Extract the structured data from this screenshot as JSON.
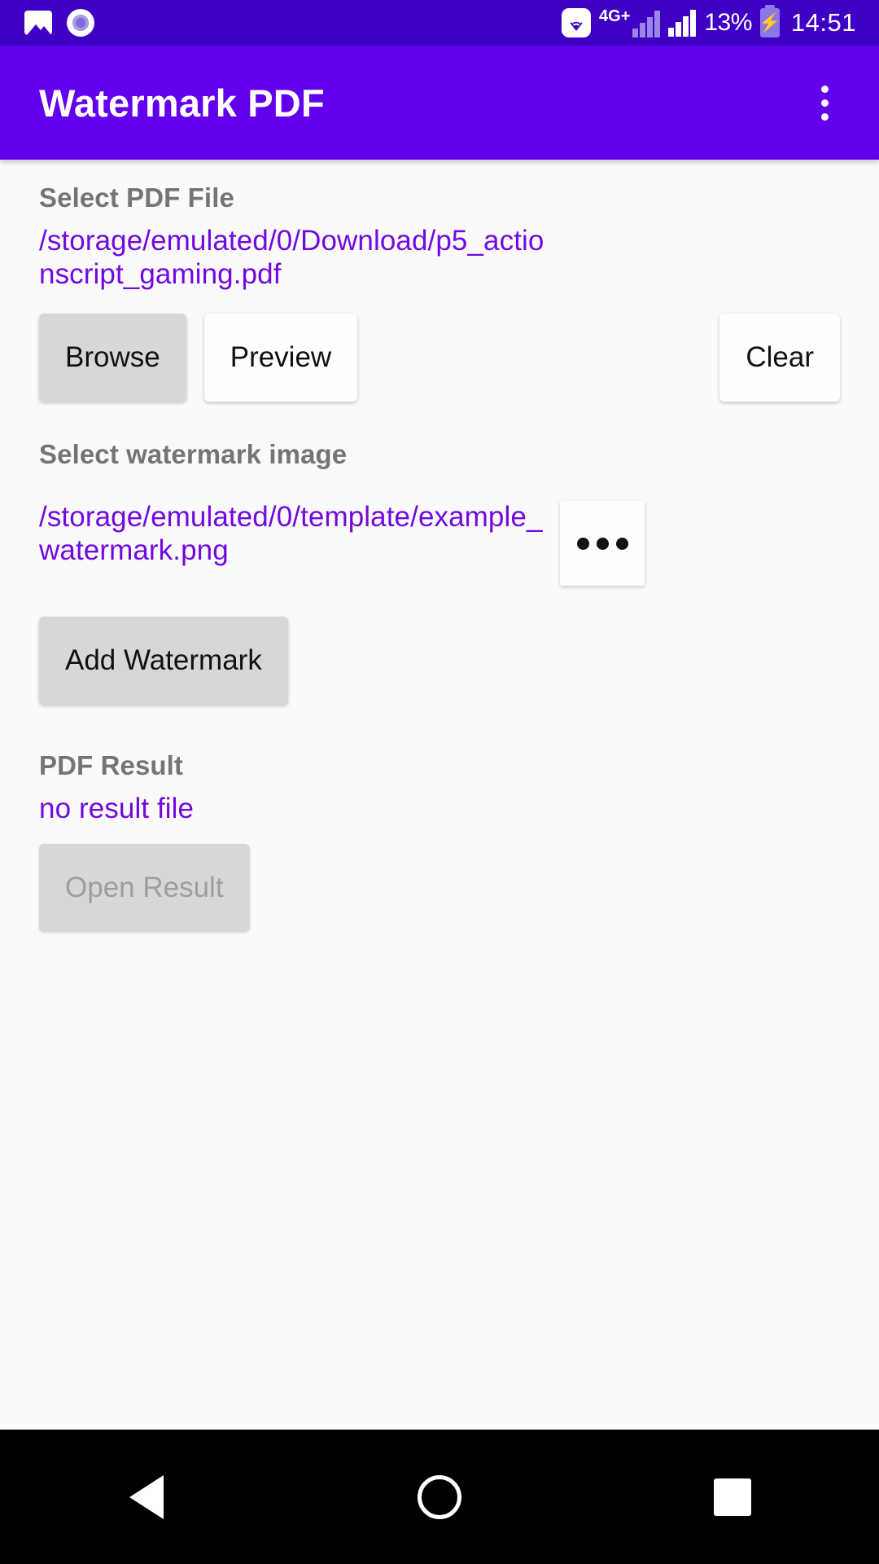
{
  "status_bar": {
    "icons_left": [
      "photo-icon",
      "screen-record-icon"
    ],
    "wifi_icon": "wifi-icon",
    "network_label": "4G+",
    "signal_icon_1": "signal-bars-icon",
    "signal_icon_2": "signal-bars-icon",
    "battery_percent": "13%",
    "battery_icon": "battery-charging-icon",
    "clock": "14:51"
  },
  "app_bar": {
    "title": "Watermark PDF",
    "overflow_icon": "more-vertical-icon"
  },
  "main": {
    "pdf_section": {
      "label": "Select PDF File",
      "path": "/storage/emulated/0/Download/p5_actionscript_gaming.pdf",
      "browse_label": "Browse",
      "preview_label": "Preview",
      "clear_label": "Clear"
    },
    "watermark_section": {
      "label": "Select watermark image",
      "path": "/storage/emulated/0/template/example_watermark.png",
      "more_label": "•••",
      "add_label": "Add Watermark"
    },
    "result_section": {
      "label": "PDF Result",
      "value": "no result file",
      "open_label": "Open Result"
    }
  },
  "nav_bar": {
    "back": "back-icon",
    "home": "home-icon",
    "recents": "recents-icon"
  },
  "colors": {
    "status_bar": "#3d00c4",
    "app_bar": "#6200ee",
    "accent_link": "#7209e0",
    "label_gray": "#757575",
    "background": "#fafafa"
  }
}
